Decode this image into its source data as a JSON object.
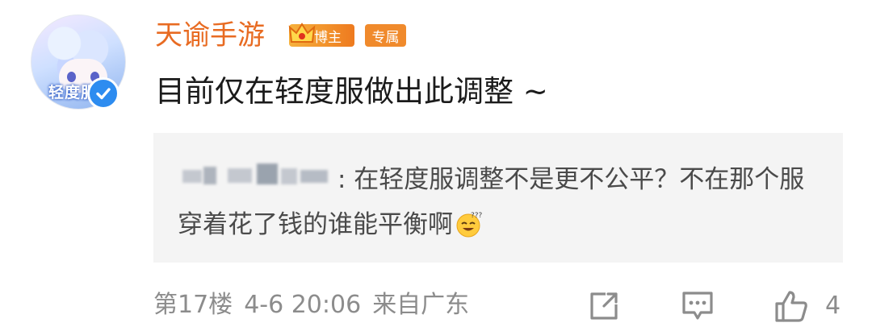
{
  "comment": {
    "author": {
      "name": "天谕手游",
      "badge_blogger": "博主",
      "badge_exclusive": "专属",
      "avatar_caption": "轻度服",
      "verified": true
    },
    "text": "目前仅在轻度服做出此调整 ~",
    "quoted_reply": {
      "author_display": "[blurred]",
      "text": ": 在轻度服调整不是更不公平？不在那个服穿着花了钱的谁能平衡啊"
    },
    "footer": {
      "floor": "第17楼",
      "time": "4-6 20:06",
      "location": "来自广东",
      "like_count": "4"
    }
  },
  "icons": {
    "share": "share-icon",
    "comment": "comment-icon",
    "like": "thumbs-up-icon",
    "verified": "verified-check-icon",
    "crown": "crown-icon",
    "emoji": "sweat-smile-emoji"
  },
  "colors": {
    "username": "#e86b22",
    "badge_blogger": "#f29a2e",
    "badge_exclusive": "#f08a2c",
    "verified": "#2d8cf0",
    "quote_bg": "#f4f4f4",
    "meta": "#8c8c8c"
  }
}
